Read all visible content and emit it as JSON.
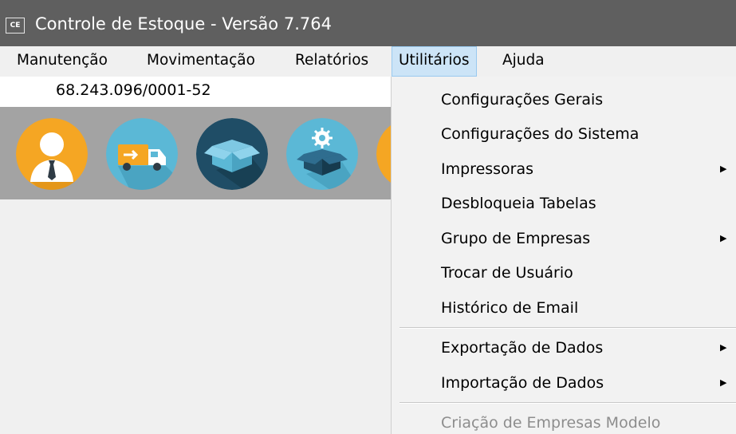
{
  "window": {
    "app_icon_text": "CE",
    "title": "Controle de Estoque - Versão 7.764"
  },
  "menubar": {
    "items": [
      {
        "label": "Manutenção"
      },
      {
        "label": "Movimentação"
      },
      {
        "label": "Relatórios"
      },
      {
        "label": "Utilitários",
        "active": true
      },
      {
        "label": "Ajuda"
      }
    ]
  },
  "company": {
    "cnpj": "68.243.096/0001-52"
  },
  "toolbar": {
    "buttons": [
      {
        "icon": "user-icon"
      },
      {
        "icon": "delivery-truck-icon"
      },
      {
        "icon": "box-icon"
      },
      {
        "icon": "box-settings-icon"
      },
      {
        "icon": "partial-icon"
      }
    ]
  },
  "utilitarios_menu": {
    "items": [
      {
        "label": "Configurações Gerais"
      },
      {
        "label": "Configurações do Sistema"
      },
      {
        "label": "Impressoras",
        "submenu": true
      },
      {
        "label": "Desbloqueia Tabelas"
      },
      {
        "label": "Grupo de Empresas",
        "submenu": true
      },
      {
        "label": "Trocar de Usuário"
      },
      {
        "label": "Histórico de Email"
      },
      {
        "label": "Exportação de Dados",
        "submenu": true
      },
      {
        "label": "Importação de Dados",
        "submenu": true
      },
      {
        "label": "Criação de Empresas Modelo",
        "disabled": true
      }
    ],
    "submenu_arrow": "▶"
  },
  "colors": {
    "titlebar": "#5f5f5f",
    "menu_active": "#cce4f7",
    "toolbar_bg": "#a3a3a3",
    "icon_orange": "#f5a623",
    "icon_lightblue": "#5bb8d6",
    "icon_darkblue": "#1f4d66"
  }
}
